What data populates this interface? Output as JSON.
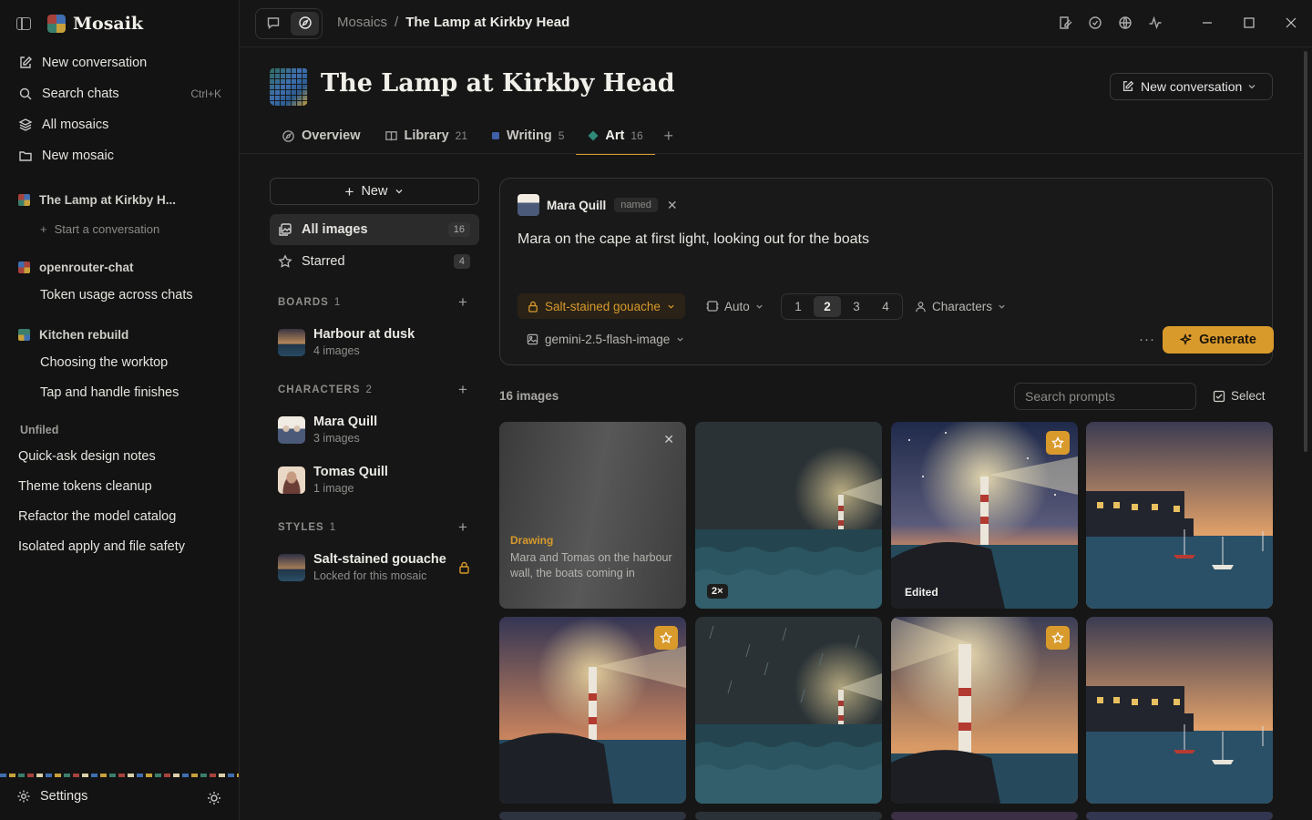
{
  "brand": {
    "name": "Mosaik"
  },
  "sidebar": {
    "nav": [
      {
        "label": "New conversation",
        "icon": "edit-icon"
      },
      {
        "label": "Search chats",
        "icon": "search-icon",
        "shortcut": "Ctrl+K"
      },
      {
        "label": "All mosaics",
        "icon": "layers-icon"
      },
      {
        "label": "New mosaic",
        "icon": "folder-icon"
      }
    ],
    "groups": [
      {
        "title": "The Lamp at Kirkby H...",
        "add_label": "Start a conversation"
      },
      {
        "title": "openrouter-chat",
        "items": [
          "Token usage across chats"
        ]
      },
      {
        "title": "Kitchen rebuild",
        "items": [
          "Choosing the worktop",
          "Tap and handle finishes"
        ]
      }
    ],
    "unfiled_title": "Unfiled",
    "unfiled": [
      "Quick-ask design notes",
      "Theme tokens cleanup",
      "Refactor the model catalog",
      "Isolated apply and file safety"
    ],
    "settings_label": "Settings"
  },
  "topbar": {
    "breadcrumb_root": "Mosaics",
    "breadcrumb_sep": "/",
    "breadcrumb_current": "The Lamp at Kirkby Head"
  },
  "header": {
    "title": "The Lamp at Kirkby Head",
    "new_conversation_label": "New conversation"
  },
  "tabs": [
    {
      "label": "Overview",
      "count": ""
    },
    {
      "label": "Library",
      "count": "21"
    },
    {
      "label": "Writing",
      "count": "5"
    },
    {
      "label": "Art",
      "count": "16"
    }
  ],
  "left_panel": {
    "new_label": "New",
    "all_images": {
      "label": "All images",
      "count": "16"
    },
    "starred": {
      "label": "Starred",
      "count": "4"
    },
    "boards": {
      "title": "BOARDS",
      "count": "1",
      "items": [
        {
          "name": "Harbour at dusk",
          "meta": "4 images"
        }
      ]
    },
    "characters": {
      "title": "CHARACTERS",
      "count": "2",
      "items": [
        {
          "name": "Mara Quill",
          "meta": "3 images"
        },
        {
          "name": "Tomas Quill",
          "meta": "1 image"
        }
      ]
    },
    "styles": {
      "title": "STYLES",
      "count": "1",
      "items": [
        {
          "name": "Salt-stained gouache",
          "meta": "Locked for this mosaic"
        }
      ]
    }
  },
  "composer": {
    "character_name": "Mara Quill",
    "character_tag": "named",
    "prompt": "Mara on the cape at first light, looking out for the boats",
    "style_label": "Salt-stained gouache",
    "aspect_label": "Auto",
    "counts": [
      "1",
      "2",
      "3",
      "4"
    ],
    "selected_count": "2",
    "characters_label": "Characters",
    "model_label": "gemini-2.5-flash-image",
    "more_label": "···",
    "generate_label": "Generate"
  },
  "gallery": {
    "count_label": "16 images",
    "search_placeholder": "Search prompts",
    "select_label": "Select",
    "drawing": {
      "type": "Drawing",
      "text": "Mara and Tomas on the harbour wall, the boats coming in"
    },
    "badges": {
      "multi": "2×",
      "edited": "Edited"
    }
  },
  "colors": {
    "accent": "#d99a2c",
    "background": "#161616",
    "sidebar": "#131313"
  }
}
